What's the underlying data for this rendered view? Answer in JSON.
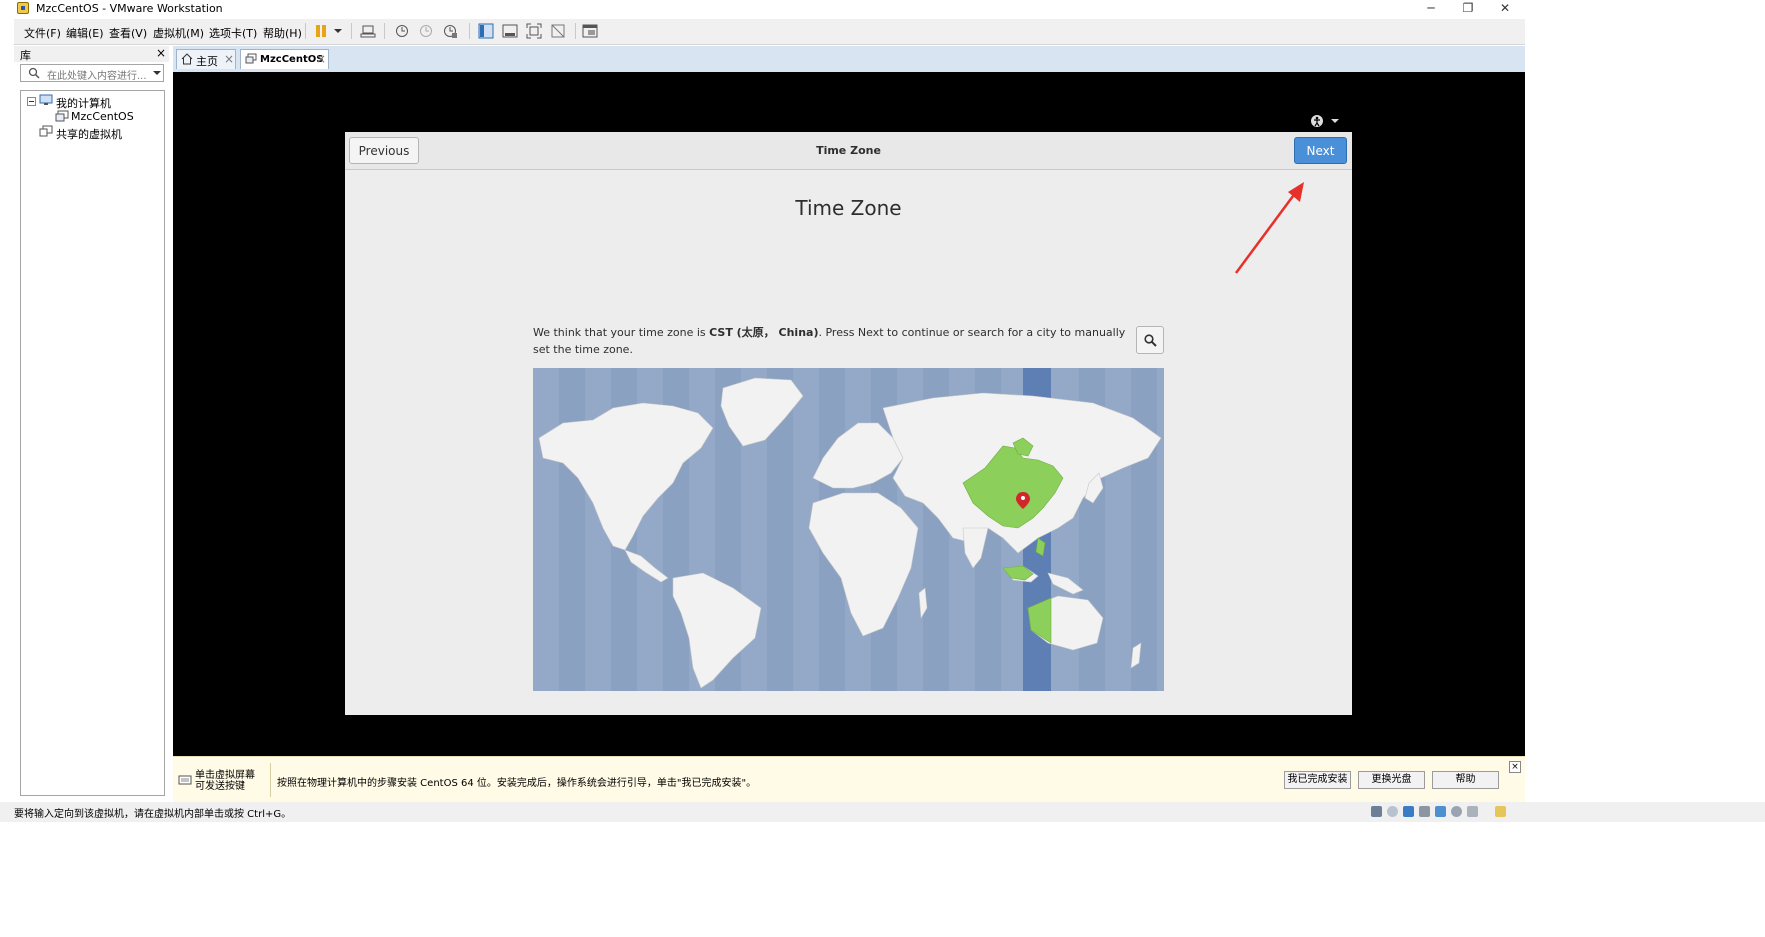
{
  "window": {
    "title": "MzcCentOS - VMware Workstation",
    "minimize_icon": "─",
    "restore_icon": "❐",
    "close_icon": "✕"
  },
  "menu": {
    "items": [
      "文件(F)",
      "编辑(E)",
      "查看(V)",
      "虚拟机(M)",
      "选项卡(T)",
      "帮助(H)"
    ]
  },
  "library": {
    "title": "库",
    "close": "×",
    "search_placeholder": "在此处键入内容进行...",
    "tree": {
      "my_computer": "我的计算机",
      "vm": "MzcCentOS",
      "shared": "共享的虚拟机"
    }
  },
  "tabs": [
    {
      "label": "主页",
      "close": "×"
    },
    {
      "label": "MzcCentOS",
      "close": "×"
    }
  ],
  "installer": {
    "accessibility_icon": "accessibility-icon",
    "previous_label": "Previous",
    "header_title": "Time Zone",
    "next_label": "Next",
    "page_title": "Time Zone",
    "info_prefix": "We think that your time zone is ",
    "info_zone": "CST (太原， China)",
    "info_suffix": ". Press Next to continue or search for a city to manually set the time zone.",
    "search_icon": "search-icon"
  },
  "hintbar": {
    "left_line1": "单击虚拟屏幕",
    "left_line2": "可发送按键",
    "text": "按照在物理计算机中的步骤安装 CentOS 64 位。安装完成后，操作系统会进行引导，单击\"我已完成安装\"。",
    "btn_done": "我已完成安装",
    "btn_change_disc": "更换光盘",
    "btn_help": "帮助",
    "close": "×"
  },
  "statusbar": {
    "text": "要将输入定向到该虚拟机，请在虚拟机内部单击或按 Ctrl+G。"
  },
  "colors": {
    "ocean": "#93a9c7",
    "land": "#f2f2f2",
    "selected_region": "#8ccf5a",
    "selected_band": "#5d7fb4",
    "next_button": "#4a90d9",
    "arrow": "#e8302a"
  }
}
